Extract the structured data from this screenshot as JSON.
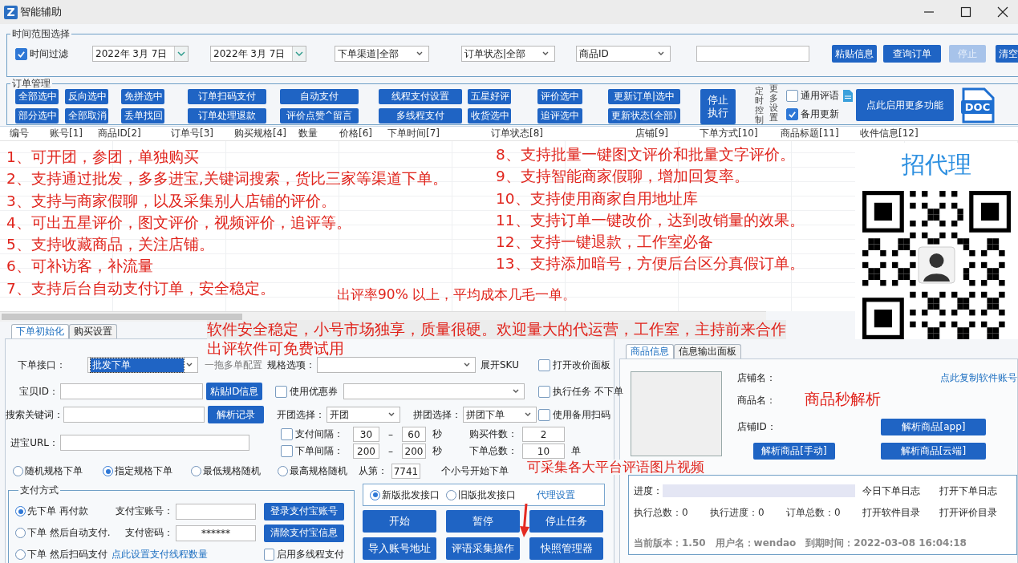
{
  "window": {
    "logo": "Z",
    "title": "智能辅助"
  },
  "time_range": {
    "legend": "时间范围选择",
    "filter": {
      "label": "时间过滤",
      "checked": true
    },
    "dates": [
      "2022年 3月 7日",
      "2022年 3月 7日"
    ],
    "selects": [
      "下单渠道|全部",
      "订单状态|全部",
      "商品ID"
    ],
    "buttons": [
      {
        "label": "粘贴信息",
        "disabled": false
      },
      {
        "label": "查询订单",
        "disabled": false
      },
      {
        "label": "停止",
        "disabled": true
      },
      {
        "label": "清空",
        "disabled": false
      }
    ]
  },
  "order_management": {
    "legend": "订单管理",
    "button_columns": [
      [
        "全部选中",
        "部分选中"
      ],
      [
        "反向选中",
        "全部取消"
      ],
      [
        "免拼选中",
        "丢单找回"
      ],
      [
        "订单扫码支付",
        "订单处理退款"
      ],
      [
        "自动支付",
        "评价点赞^留言"
      ],
      [
        "线程支付设置",
        "多线程支付"
      ],
      [
        "五星好评",
        "收货选中"
      ],
      [
        "评价选中",
        "追评选中"
      ],
      [
        "更新订单|选中",
        "更新状态(全部)"
      ]
    ],
    "stop_button": "停止执行",
    "vertical_labels": [
      "定时控制",
      "更多设置"
    ],
    "checkboxes": [
      {
        "label": "通用评语",
        "checked": false
      },
      {
        "label": "备用更新",
        "checked": true
      }
    ],
    "more_button": "点此启用更多功能",
    "doc_label": "DOC"
  },
  "table": {
    "columns": [
      "编号",
      "账号[1]",
      "商品ID[2]",
      "订单号[3]",
      "购买规格[4]",
      "数量",
      "价格[6]",
      "下单时间[7]",
      "订单状态[8]",
      "店铺[9]",
      "下单方式[10]",
      "商品标题[11]",
      "收件信息[12]"
    ]
  },
  "promo": {
    "left": [
      "1、可开团，参团，单独购买",
      "2、支持通过批发，多多进宝,关键词搜索，货比三家等渠道下单。",
      "3、支持与商家假聊，以及采集别人店铺的评价。",
      "4、可出五星评价，图文评价，视频评价，追评等。",
      "5、支持收藏商品，关注店铺。",
      "6、可补访客，补流量",
      "7、支持后台自动支付订单，安全稳定。"
    ],
    "right": [
      "8、支持批量一键图文评价和批量文字评价。",
      "9、支持智能商家假聊，增加回复率。",
      "10、支持使用商家自用地址库",
      "11、支持订单一键改价，达到改销量的效果。",
      "12、支持一键退款，工作室必备",
      "13、支持添加暗号，方便后台区分真假订单。"
    ],
    "note": "出评率90% 以上，平均成本几毛一单。"
  },
  "agent": {
    "title": "招代理"
  },
  "annotations": [
    {
      "text": "软件安全稳定，小号市场独享，质量很硬。欢迎量大的代运营，工作室，主持前来合作"
    },
    {
      "text": "出评软件可免费试用"
    },
    {
      "text": "商品秒解析"
    },
    {
      "text": "可采集各大平台评语图片视频"
    }
  ],
  "order_setup": {
    "tabs": [
      {
        "label": "下单初始化",
        "selected": true
      },
      {
        "label": "购买设置",
        "selected": false
      }
    ],
    "interface": {
      "label": "下单接口：",
      "value": "批发下单"
    },
    "multi_config": "一拖多单配置",
    "spec_label": "规格选项：",
    "expand_sku": "展开SKU",
    "options": [
      {
        "label": "打开改价面板",
        "checked": false
      },
      {
        "label": "执行任务 不下单",
        "checked": false
      },
      {
        "label": "使用备用扫码",
        "checked": false
      }
    ],
    "item_id": {
      "label": "宝贝ID：",
      "button": "粘贴ID信息"
    },
    "keyword": {
      "label": "搜索关键词：",
      "button": "解析记录"
    },
    "url_label": "进宝URL：",
    "coupon": {
      "label": "使用优惠券",
      "checked": false
    },
    "group_open": {
      "label": "开团选择：",
      "value": "开团"
    },
    "group_join": {
      "label": "拼团选择：",
      "value": "拼团下单"
    },
    "intervals": [
      {
        "label": "支付间隔：",
        "checked": false,
        "from": "30",
        "sep": "–",
        "to": "60",
        "unit": "秒"
      },
      {
        "label": "下单间隔：",
        "checked": false,
        "from": "200",
        "sep": "–",
        "to": "200",
        "unit": "秒"
      }
    ],
    "quantities": [
      {
        "label": "购买件数：",
        "value": "2"
      },
      {
        "label": "下单总数：",
        "value": "10",
        "unit": "单"
      }
    ],
    "spec_modes": [
      {
        "label": "随机规格下单",
        "selected": false
      },
      {
        "label": "指定规格下单",
        "selected": true
      },
      {
        "label": "最低规格随机",
        "selected": false
      },
      {
        "label": "最高规格随机",
        "selected": false
      }
    ],
    "start_from": {
      "label": "从第：",
      "value": "7741",
      "suffix": "个小号开始下单"
    },
    "payment": {
      "legend": "支付方式",
      "modes": [
        {
          "label": "先下单 再付款",
          "selected": true
        },
        {
          "label": "下单 然后自动支付.",
          "selected": false
        },
        {
          "label": "下单 然后扫码支付",
          "selected": false
        }
      ],
      "account_label": "支付宝账号：",
      "password_label": "支付密码：",
      "password": "******",
      "link": "点此设置支付线程数量",
      "buttons": [
        "登录支付宝账号",
        "清除支付宝信息"
      ],
      "multithread": {
        "label": "启用多线程支付",
        "checked": false
      }
    },
    "api": {
      "versions": [
        {
          "label": "新版批发接口",
          "selected": true
        },
        {
          "label": "旧版批发接口",
          "selected": false
        }
      ],
      "link": "代理设置"
    },
    "actions": [
      "开始",
      "暂停",
      "停止任务",
      "导入账号地址",
      "评语采集操作",
      "快照管理器"
    ]
  },
  "product": {
    "tabs": [
      {
        "label": "商品信息",
        "selected": true
      },
      {
        "label": "信息输出面板",
        "selected": false
      }
    ],
    "fields": [
      "店铺名：",
      "商品名：",
      "店铺ID："
    ],
    "copy_link": "点此复制软件账号",
    "parse_buttons": [
      "解析商品[app]",
      "解析商品[手动]",
      "解析商品[云端]"
    ]
  },
  "status": {
    "progress_label": "进度：",
    "level": 0,
    "log_links": [
      "今日下单日志",
      "打开下单日志",
      "打开软件目录",
      "打开评价目录"
    ],
    "counters": [
      "执行总数：0",
      "执行进度：0",
      "订单总数：0"
    ],
    "info": [
      "当前版本：1.50",
      "用户名：wendao",
      "到期时间：2022-03-08 16:04:18"
    ]
  }
}
